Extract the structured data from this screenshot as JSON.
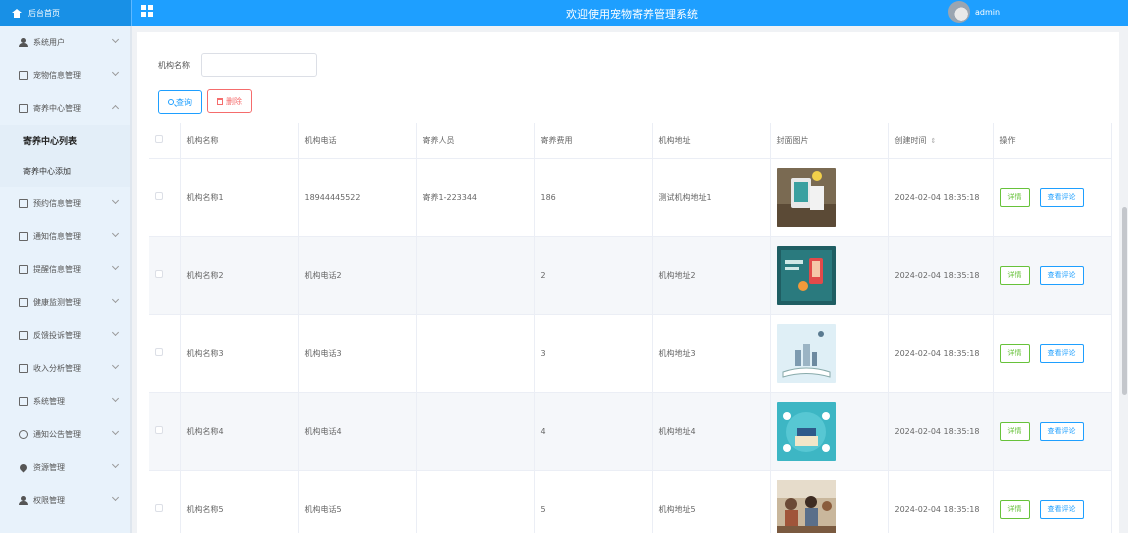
{
  "header": {
    "home_label": "后台首页",
    "title": "欢迎使用宠物寄养管理系统",
    "user": "admin"
  },
  "sidebar": {
    "items": [
      {
        "label": "系统用户",
        "icon": "user-icon",
        "expanded": false
      },
      {
        "label": "宠物信息管理",
        "icon": "doc-icon",
        "expanded": false
      },
      {
        "label": "寄养中心管理",
        "icon": "doc-icon",
        "expanded": true
      },
      {
        "label": "预约信息管理",
        "icon": "doc-icon",
        "expanded": false
      },
      {
        "label": "通知信息管理",
        "icon": "doc-icon",
        "expanded": false
      },
      {
        "label": "提醒信息管理",
        "icon": "doc-icon",
        "expanded": false
      },
      {
        "label": "健康监测管理",
        "icon": "doc-icon",
        "expanded": false
      },
      {
        "label": "反馈投诉管理",
        "icon": "doc-icon",
        "expanded": false
      },
      {
        "label": "收入分析管理",
        "icon": "doc-icon",
        "expanded": false
      },
      {
        "label": "系统管理",
        "icon": "image-icon",
        "expanded": false
      },
      {
        "label": "通知公告管理",
        "icon": "info-icon",
        "expanded": false
      },
      {
        "label": "资源管理",
        "icon": "location-icon",
        "expanded": false
      },
      {
        "label": "权限管理",
        "icon": "user-icon",
        "expanded": false
      }
    ],
    "submenu": [
      {
        "label": "寄养中心列表",
        "active": true
      },
      {
        "label": "寄养中心添加",
        "active": false
      }
    ]
  },
  "search": {
    "label": "机构名称",
    "value": "",
    "query_label": "查询",
    "delete_label": "删除"
  },
  "table": {
    "headers": [
      "机构名称",
      "机构电话",
      "寄养人员",
      "寄养费用",
      "机构地址",
      "封面图片",
      "创建时间",
      "操作"
    ],
    "rows": [
      {
        "name": "机构名称1",
        "phone": "18944445522",
        "staff": "寄养1-223344",
        "fee": "186",
        "address": "测试机构地址1",
        "created": "2024-02-04 18:35:18"
      },
      {
        "name": "机构名称2",
        "phone": "机构电话2",
        "staff": "",
        "fee": "2",
        "address": "机构地址2",
        "created": "2024-02-04 18:35:18"
      },
      {
        "name": "机构名称3",
        "phone": "机构电话3",
        "staff": "",
        "fee": "3",
        "address": "机构地址3",
        "created": "2024-02-04 18:35:18"
      },
      {
        "name": "机构名称4",
        "phone": "机构电话4",
        "staff": "",
        "fee": "4",
        "address": "机构地址4",
        "created": "2024-02-04 18:35:18"
      },
      {
        "name": "机构名称5",
        "phone": "机构电话5",
        "staff": "",
        "fee": "5",
        "address": "机构地址5",
        "created": "2024-02-04 18:35:18"
      }
    ],
    "detail_label": "详情",
    "review_label": "查看评论"
  },
  "colors": {
    "primary": "#1e9fff",
    "danger": "#f56c6c",
    "success": "#67c23a",
    "sidebar_bg": "#e8f2fb"
  }
}
